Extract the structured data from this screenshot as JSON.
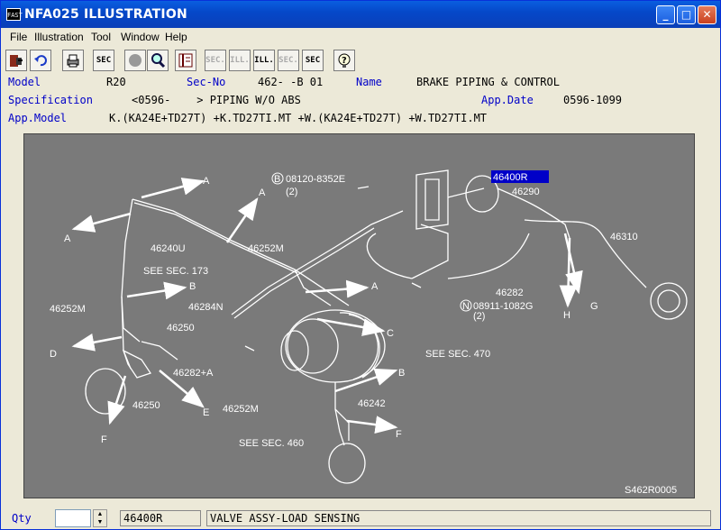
{
  "window": {
    "app_icon": "FAST",
    "title": "NFA025  ILLUSTRATION",
    "minimize": "_",
    "maximize": "□",
    "close": "✕"
  },
  "menu": [
    "File",
    "Illustration",
    "Tool",
    "Window",
    "Help"
  ],
  "toolbar": {
    "sec_label": "SEC",
    "sec_back_label": "SEC.",
    "ill_back_label": "ILL.",
    "ill_label": "ILL.",
    "sec_fwd_label": "SEC.",
    "sec_q_label": "SEC",
    "icons": [
      "exit-icon",
      "undo-icon",
      "print-icon",
      "sec-icon",
      "circle-icon",
      "zoom-icon",
      "book-icon",
      "sec-back-icon",
      "ill-back-icon",
      "ill-icon",
      "sec-forward-icon",
      "sec-query-icon",
      "help-icon"
    ]
  },
  "info": {
    "model_label": "Model",
    "model_value": "R20",
    "secno_label": "Sec-No",
    "secno_value": "462-  -B 01",
    "name_label": "Name",
    "name_value": "BRAKE PIPING & CONTROL",
    "spec_label": "Specification",
    "spec_value": "<0596-    > PIPING W/O ABS",
    "appdate_label": "App.Date",
    "appdate_value": "0596-1099",
    "appmodel_label": "App.Model",
    "appmodel_value": "K.(KA24E+TD27T) +K.TD27TI.MT +W.(KA24E+TD27T) +W.TD27TI.MT"
  },
  "illustration": {
    "selected_part": "46400R",
    "labels": {
      "bolt": "08120-8352E",
      "bolt_qty": "(2)",
      "bolt_mark": "B",
      "nut": "08911-1082G",
      "nut_qty": "(2)",
      "nut_mark": "N",
      "p46290": "46290",
      "p46310": "46310",
      "p46240u": "46240U",
      "p46252m_a": "46252M",
      "p46252m_b": "46252M",
      "p46252m_c": "46252M",
      "p46284n": "46284N",
      "p46250_a": "46250",
      "p46250_b": "46250",
      "p46282a": "46282+A",
      "p46282": "46282",
      "p46242": "46242",
      "see173": "SEE SEC. 173",
      "see470": "SEE SEC. 470",
      "see460": "SEE SEC. 460",
      "ref": "S462R0005",
      "A": "A",
      "B": "B",
      "C": "C",
      "D": "D",
      "E": "E",
      "F": "F",
      "G": "G",
      "H": "H"
    }
  },
  "status": {
    "qty_label": "Qty",
    "part_no": "46400R",
    "part_name": "VALVE ASSY-LOAD SENSING"
  }
}
